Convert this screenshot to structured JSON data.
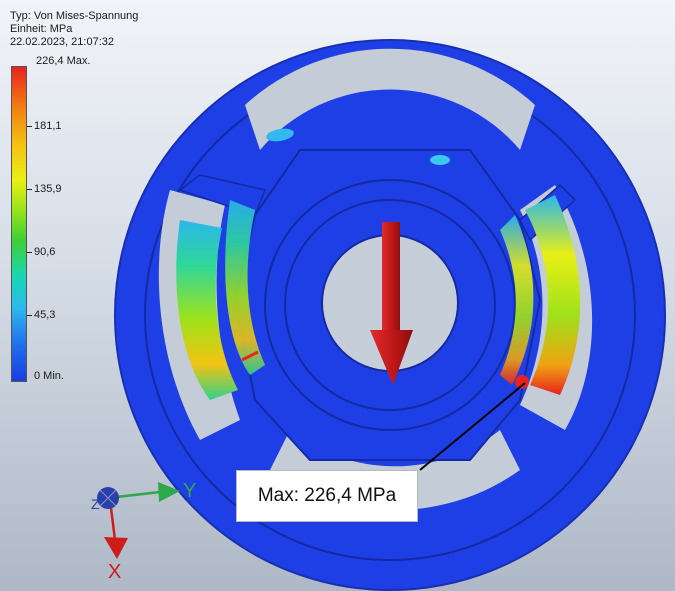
{
  "header": {
    "type_line": "Typ: Von Mises-Spannung",
    "unit_line": "Einheit: MPa",
    "date_line": "22.02.2023, 21:07:32"
  },
  "legend": {
    "max_label": "226,4 Max.",
    "levels": [
      "181,1",
      "135,9",
      "90,6",
      "45,3"
    ],
    "min_label": "0 Min."
  },
  "callout": {
    "text": "Max: 226,4 MPa"
  },
  "triad": {
    "y_label": "Y",
    "x_label": "X",
    "z_label": "Z"
  },
  "colors": {
    "part_blue": "#1f3fe6",
    "highlight_red": "#e8221e",
    "load_arrow": "#c21818",
    "triad_green": "#2da84a",
    "triad_red": "#cc1c1c",
    "triad_blue": "#2a3fa8"
  }
}
